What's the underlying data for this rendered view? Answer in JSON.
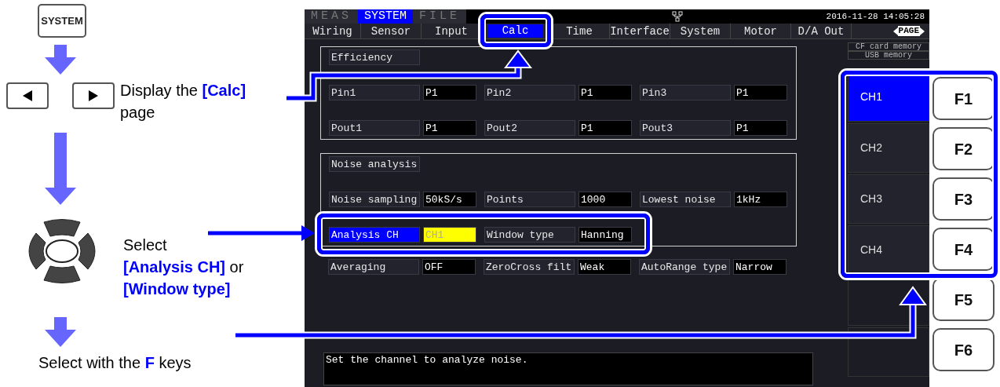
{
  "guide": {
    "system_key": "SYSTEM",
    "steps": [
      {
        "kind": "arrows",
        "text": "Display the **[Calc]** page"
      },
      {
        "kind": "dpad",
        "lines": [
          "Select",
          "**[Analysis CH]** or\n**[Window type]**"
        ]
      },
      {
        "kind": "fkeys",
        "text": "Select with the **F** keys"
      }
    ]
  },
  "screen": {
    "mode_tabs": [
      {
        "label": "MEAS",
        "selected": false
      },
      {
        "label": "SYSTEM",
        "selected": true
      },
      {
        "label": "FILE",
        "selected": false
      }
    ],
    "datetime": "2016-11-28 14:05:28",
    "page_tabs": [
      {
        "label": "Wiring",
        "selected": false
      },
      {
        "label": "Sensor",
        "selected": false
      },
      {
        "label": "Input",
        "selected": false
      },
      {
        "label": "Calc",
        "selected": true
      },
      {
        "label": "Time",
        "selected": false
      },
      {
        "label": "Interface",
        "selected": false
      },
      {
        "label": "System",
        "selected": false
      },
      {
        "label": "Motor",
        "selected": false
      },
      {
        "label": "D/A Out",
        "selected": false
      }
    ],
    "page_indicator": "PAGE",
    "groups": [
      {
        "title": "Efficiency",
        "rows": [
          [
            {
              "label": "Pin1",
              "value": "P1",
              "selected": false
            },
            {
              "label": "Pin2",
              "value": "P1",
              "selected": false
            },
            {
              "label": "Pin3",
              "value": "P1",
              "selected": false
            }
          ],
          [
            {
              "label": "Pout1",
              "value": "P1",
              "selected": false
            },
            {
              "label": "Pout2",
              "value": "P1",
              "selected": false
            },
            {
              "label": "Pout3",
              "value": "P1",
              "selected": false
            }
          ]
        ]
      },
      {
        "title": "Noise analysis",
        "rows": [
          [
            {
              "label": "Noise sampling",
              "value": "50kS/s",
              "selected": false
            },
            {
              "label": "Points",
              "value": "1000",
              "selected": false
            },
            {
              "label": "Lowest noise",
              "value": "1kHz",
              "selected": false
            }
          ],
          [
            {
              "label": "Analysis CH",
              "value": "CH1",
              "selected": true
            },
            {
              "label": "Window type",
              "value": "Hanning",
              "selected": false
            }
          ]
        ]
      }
    ],
    "extra_rows": [
      [
        {
          "label": "Averaging",
          "value": "OFF",
          "selected": false
        },
        {
          "label": "ZeroCross filt",
          "value": "Weak",
          "selected": false
        },
        {
          "label": "AutoRange type",
          "value": "Narrow",
          "selected": false
        }
      ]
    ],
    "storage": [
      "CF card memory",
      "USB memory"
    ],
    "function_menu": [
      {
        "label": "CH1",
        "selected": true
      },
      {
        "label": "CH2",
        "selected": false
      },
      {
        "label": "CH3",
        "selected": false
      },
      {
        "label": "CH4",
        "selected": false
      }
    ],
    "message": "Set the channel to analyze noise."
  },
  "function_keys": [
    "F1",
    "F2",
    "F3",
    "F4",
    "F5",
    "F6"
  ]
}
